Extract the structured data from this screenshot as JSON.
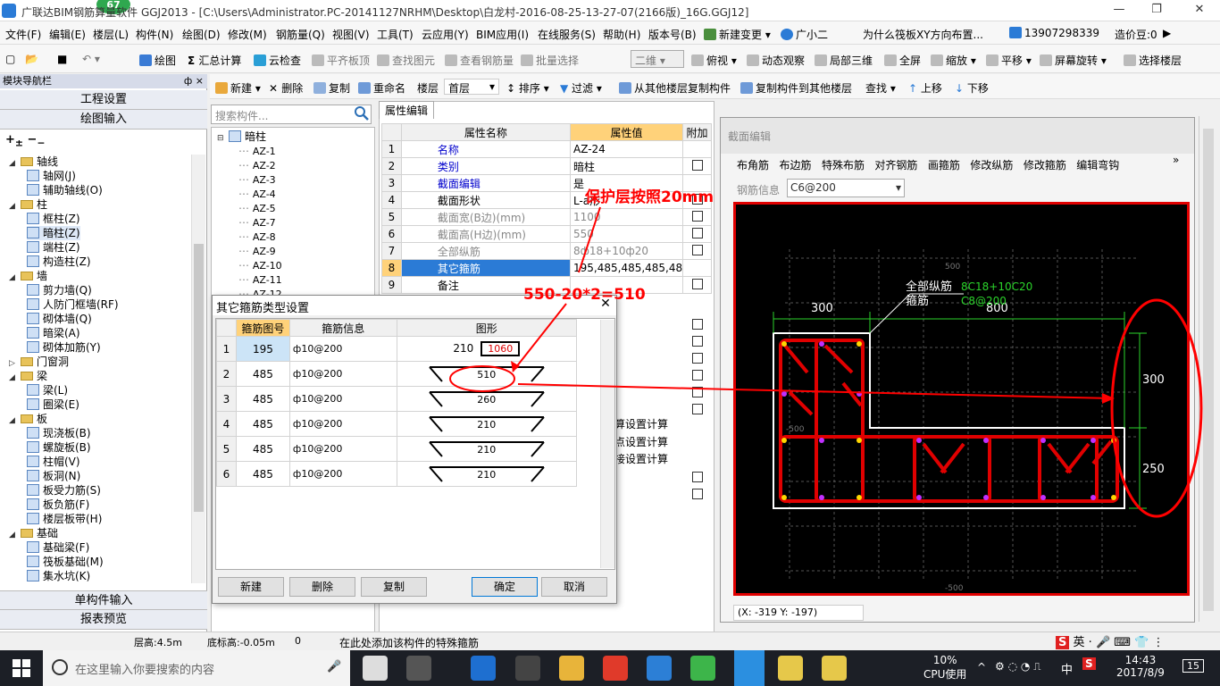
{
  "window": {
    "title": "广联达BIM钢筋算量软件 GGJ2013 - [C:\\Users\\Administrator.PC-20141127NRHM\\Desktop\\白龙村-2016-08-25-13-27-07(2166版)_16G.GGJ12]",
    "badge": "67",
    "controls": [
      "—",
      "❐",
      "✕"
    ]
  },
  "menu": [
    "文件(F)",
    "编辑(E)",
    "楼层(L)",
    "构件(N)",
    "绘图(D)",
    "修改(M)",
    "钢筋量(Q)",
    "视图(V)",
    "工具(T)",
    "云应用(Y)",
    "BIM应用(I)",
    "在线服务(S)",
    "帮助(H)",
    "版本号(B)",
    "新建变更 ▾",
    "广小二"
  ],
  "menu_right": {
    "question": "为什么筏板XY方向布置...",
    "phone": "13907298339",
    "beans": "造价豆:0"
  },
  "toolbar1": [
    "绘图",
    "汇总计算",
    "云检查",
    "平齐板顶",
    "查找图元",
    "查看钢筋量",
    "批量选择",
    "二维",
    "俯视",
    "动态观察",
    "局部三维",
    "全屏",
    "缩放",
    "平移",
    "屏幕旋转",
    "选择楼层"
  ],
  "toolbar2": [
    "新建",
    "删除",
    "复制",
    "重命名",
    "楼层",
    "首层",
    "排序",
    "过滤",
    "从其他楼层复制构件",
    "复制构件到其他楼层",
    "查找",
    "上移",
    "下移"
  ],
  "nav": {
    "title": "模块导航栏",
    "pin": "ф ×",
    "buttons": [
      "工程设置",
      "绘图输入"
    ],
    "bottom_buttons": [
      "单构件输入",
      "报表预览"
    ],
    "tree": [
      {
        "level": 0,
        "type": "folder",
        "label": "轴线"
      },
      {
        "level": 1,
        "type": "item",
        "label": "轴网(J)"
      },
      {
        "level": 1,
        "type": "item",
        "label": "辅助轴线(O)"
      },
      {
        "level": 0,
        "type": "folder",
        "label": "柱"
      },
      {
        "level": 1,
        "type": "item",
        "label": "框柱(Z)"
      },
      {
        "level": 1,
        "type": "item",
        "label": "暗柱(Z)"
      },
      {
        "level": 1,
        "type": "item",
        "label": "端柱(Z)"
      },
      {
        "level": 1,
        "type": "item",
        "label": "构造柱(Z)"
      },
      {
        "level": 0,
        "type": "folder",
        "label": "墙"
      },
      {
        "level": 1,
        "type": "item",
        "label": "剪力墙(Q)"
      },
      {
        "level": 1,
        "type": "item",
        "label": "人防门框墙(RF)"
      },
      {
        "level": 1,
        "type": "item",
        "label": "砌体墙(Q)"
      },
      {
        "level": 1,
        "type": "item",
        "label": "暗梁(A)"
      },
      {
        "level": 1,
        "type": "item",
        "label": "砌体加筋(Y)"
      },
      {
        "level": 0,
        "type": "folder",
        "label": "门窗洞"
      },
      {
        "level": 0,
        "type": "folder",
        "label": "梁"
      },
      {
        "level": 1,
        "type": "item",
        "label": "梁(L)"
      },
      {
        "level": 1,
        "type": "item",
        "label": "圈梁(E)"
      },
      {
        "level": 0,
        "type": "folder",
        "label": "板"
      },
      {
        "level": 1,
        "type": "item",
        "label": "现浇板(B)"
      },
      {
        "level": 1,
        "type": "item",
        "label": "螺旋板(B)"
      },
      {
        "level": 1,
        "type": "item",
        "label": "柱帽(V)"
      },
      {
        "level": 1,
        "type": "item",
        "label": "板洞(N)"
      },
      {
        "level": 1,
        "type": "item",
        "label": "板受力筋(S)"
      },
      {
        "level": 1,
        "type": "item",
        "label": "板负筋(F)"
      },
      {
        "level": 1,
        "type": "item",
        "label": "楼层板带(H)"
      },
      {
        "level": 0,
        "type": "folder",
        "label": "基础"
      },
      {
        "level": 1,
        "type": "item",
        "label": "基础梁(F)"
      },
      {
        "level": 1,
        "type": "item",
        "label": "筏板基础(M)"
      },
      {
        "level": 1,
        "type": "item",
        "label": "集水坑(K)"
      }
    ]
  },
  "component": {
    "search_placeholder": "搜索构件...",
    "root": "暗柱",
    "items": [
      "AZ-1",
      "AZ-2",
      "AZ-3",
      "AZ-4",
      "AZ-5",
      "AZ-7",
      "AZ-8",
      "AZ-9",
      "AZ-10",
      "AZ-11",
      "AZ-12"
    ]
  },
  "props": {
    "tab": "属性编辑",
    "headers": [
      "属性名称",
      "属性值",
      "附加"
    ],
    "rows": [
      {
        "n": "1",
        "name": "名称",
        "value": "AZ-24",
        "style": "blue",
        "chk": false
      },
      {
        "n": "2",
        "name": "类别",
        "value": "暗柱",
        "style": "blue",
        "chk": true
      },
      {
        "n": "3",
        "name": "截面编辑",
        "value": "是",
        "style": "blue",
        "chk": false
      },
      {
        "n": "4",
        "name": "截面形状",
        "value": "L-a形",
        "style": "",
        "chk": true
      },
      {
        "n": "5",
        "name": "截面宽(B边)(mm)",
        "value": "1100",
        "style": "gray",
        "chk": true
      },
      {
        "n": "6",
        "name": "截面高(H边)(mm)",
        "value": "550",
        "style": "gray",
        "chk": true
      },
      {
        "n": "7",
        "name": "全部纵筋",
        "value": "8ф18+10ф20",
        "style": "gray",
        "chk": true
      },
      {
        "n": "8",
        "name": "其它箍筋",
        "value": "195,485,485,485,485,",
        "style": "sel",
        "chk": false
      },
      {
        "n": "9",
        "name": "备注",
        "value": "",
        "style": "",
        "chk": true
      }
    ],
    "partial": [
      "算设置计算",
      "点设置计算",
      "接设置计算"
    ]
  },
  "section": {
    "title": "截面编辑",
    "tools": [
      "布角筋",
      "布边筋",
      "特殊布筋",
      "对齐钢筋",
      "画箍筋",
      "修改纵筋",
      "修改箍筋",
      "编辑弯钩"
    ],
    "info_label": "钢筋信息",
    "info_value": "C6@200",
    "status": "(X: -319 Y: -197)",
    "labels": {
      "all_long": "全部纵筋",
      "stirrup": "箍筋",
      "long_val": "8C18+10C20",
      "stir_val": "C8@200",
      "w1": "300",
      "w2": "800",
      "h1": "300",
      "h2": "250",
      "grid_top": "500",
      "grid_left": "-500",
      "grid_bottom": "-500"
    }
  },
  "dialog": {
    "title": "其它箍筋类型设置",
    "headers": [
      "箍筋图号",
      "箍筋信息",
      "图形"
    ],
    "rows": [
      {
        "n": "1",
        "code": "195",
        "info": "ф10@200",
        "fig": "210",
        "fig2": "1060"
      },
      {
        "n": "2",
        "code": "485",
        "info": "ф10@200",
        "fig": "510"
      },
      {
        "n": "3",
        "code": "485",
        "info": "ф10@200",
        "fig": "260"
      },
      {
        "n": "4",
        "code": "485",
        "info": "ф10@200",
        "fig": "210"
      },
      {
        "n": "5",
        "code": "485",
        "info": "ф10@200",
        "fig": "210"
      },
      {
        "n": "6",
        "code": "485",
        "info": "ф10@200",
        "fig": "210"
      }
    ],
    "buttons": [
      "新建",
      "删除",
      "复制",
      "确定",
      "取消"
    ]
  },
  "annotations": {
    "cover": "保护层按照20mm",
    "calc": "550-20*2=510"
  },
  "statusbar": [
    "层高:4.5m",
    "底标高:-0.05m",
    "0",
    "在此处添加该构件的特殊箍筋"
  ],
  "taskbar": {
    "search_placeholder": "在这里输入你要搜索的内容",
    "cpu_pct": "10%",
    "cpu_label": "CPU使用",
    "ime": "中",
    "time": "14:43",
    "date": "2017/8/9",
    "notif": "15"
  },
  "ime_bar": [
    "S",
    "英",
    "·",
    "🎤",
    "⌨",
    "👕",
    "⋮"
  ],
  "colors": {
    "accent": "#0078d7",
    "annotation": "#ff0000",
    "rebar": "#e00000",
    "selection": "#cce4f7"
  }
}
